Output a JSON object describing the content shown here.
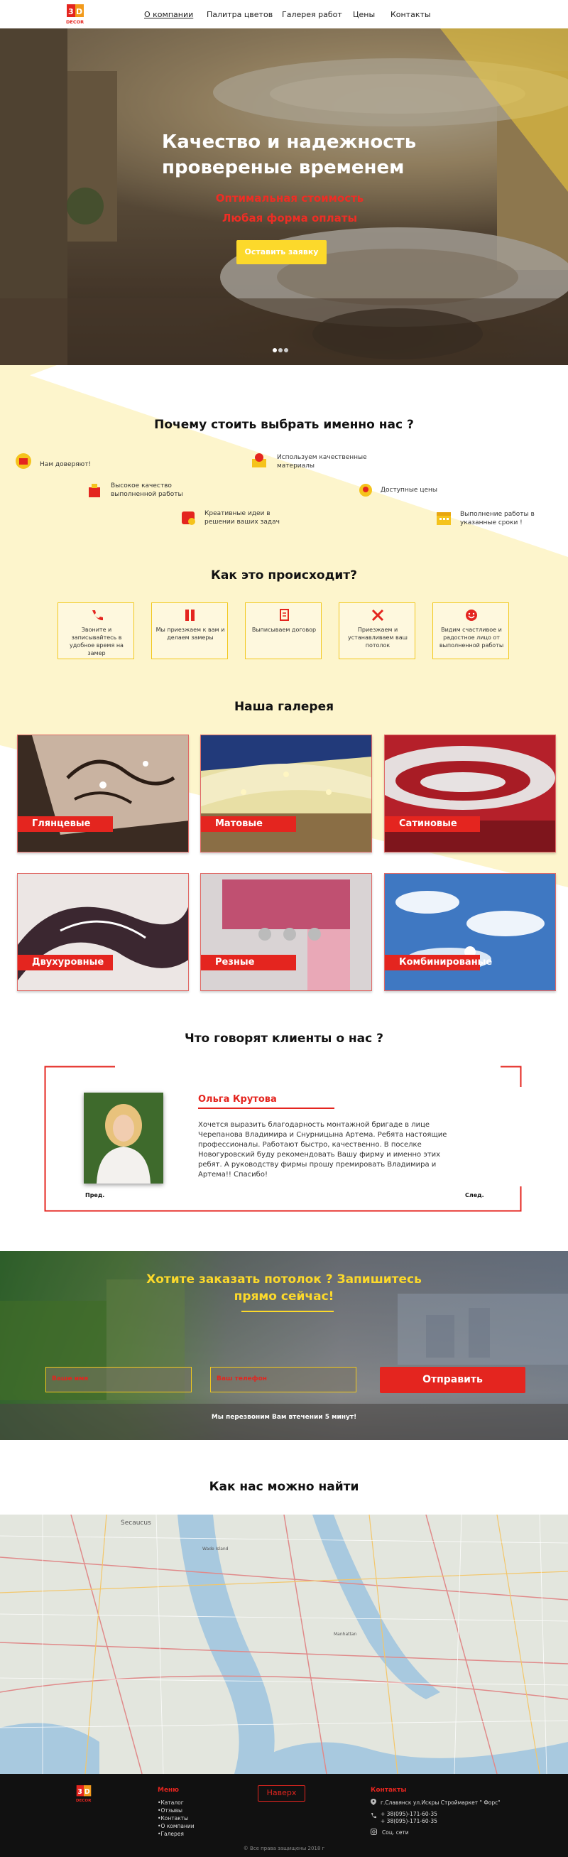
{
  "header": {
    "logo_text": "DECOR",
    "nav": [
      {
        "label": "О компании"
      },
      {
        "label": "Палитра цветов"
      },
      {
        "label": "Галерея работ"
      },
      {
        "label": "Цены"
      },
      {
        "label": "Контакты"
      }
    ]
  },
  "hero": {
    "title_line1": "Качество и надежность",
    "title_line2": "провереные временем",
    "subtitle_line1": "Оптимальная стоимость",
    "subtitle_line2": "Любая форма оплаты",
    "button_label": "Оставить заявку",
    "slides_count": 3
  },
  "why_us": {
    "title": "Почему стоить выбрать именно нас ?",
    "items": [
      {
        "label": "Нам доверяют!",
        "icon": "trust-icon"
      },
      {
        "label": "Используем качественные материалы",
        "icon": "materials-icon"
      },
      {
        "label": "Высокое качество выполненной работы",
        "icon": "quality-icon"
      },
      {
        "label": "Доступные цены",
        "icon": "price-icon"
      },
      {
        "label": "Креативные идеи в решении ваших задач",
        "icon": "idea-icon"
      },
      {
        "label": "Выполнение работы в указанные сроки !",
        "icon": "calendar-icon"
      }
    ]
  },
  "how_it_works": {
    "title": "Как это происходит?",
    "steps": [
      {
        "label": "Звоните и записывайтесь в удобное время на замер",
        "icon": "phone-icon"
      },
      {
        "label": "Мы приезжаем к вам и делаем замеры",
        "icon": "ruler-icon"
      },
      {
        "label": "Выписываем договор",
        "icon": "document-icon"
      },
      {
        "label": "Приезжаем и устанавливаем ваш потолок",
        "icon": "tools-icon"
      },
      {
        "label": "Видим счастливое и радостное лицо от выполненной работы",
        "icon": "smile-icon"
      }
    ]
  },
  "gallery": {
    "title": "Наша галерея",
    "items": [
      {
        "label": "Глянцевые"
      },
      {
        "label": "Матовые"
      },
      {
        "label": "Сатиновые"
      },
      {
        "label": "Двухуровные"
      },
      {
        "label": "Резные"
      },
      {
        "label": "Комбинированые"
      }
    ]
  },
  "reviews": {
    "title": "Что говорят клиенты о нас ?",
    "name": "Ольга Крутова",
    "text": "Хочется выразить благодарность монтажной бригаде в лице Черепанова Владимира и Снурницына Артема. Ребята настоящие профессионалы. Работают быстро, качественно. В поселке Новогуровский буду рекомендовать Вашу фирму и именно этих ребят. А руководству фирмы прошу премировать Владимира и Артема!! Спасибо!",
    "prev_label": "Пред.",
    "next_label": "След."
  },
  "order": {
    "title_line1": "Хотите заказать потолок ? Запишитесь",
    "title_line2": "прямо сейчас!",
    "name_placeholder": "Ваше имя",
    "phone_placeholder": "Ваш телефон",
    "submit_label": "Отправить",
    "note": "Мы перезвоним Вам втечении 5 минут!"
  },
  "map_section": {
    "title": "Как нас можно найти",
    "labels": [
      "Secaucus",
      "Wade Island",
      "Manhattan"
    ]
  },
  "footer": {
    "menu_title": "Меню",
    "menu_items": [
      "Каталог",
      "Отзывы",
      "Контакты",
      "О компании",
      "Галерея"
    ],
    "up_label": "Наверх",
    "contacts_title": "Контакты",
    "address": "г.Славянск ул.Искры Строймаркет \" Форс\"",
    "phone1": "+ 38(095)-171-60-35",
    "phone2": "+ 38(095)-171-60-35",
    "social": "Соц. сети",
    "copyright": "© Все права защищены 2018 г"
  },
  "colors": {
    "accent_red": "#e4251f",
    "accent_yellow": "#fcd92b",
    "footer_bg": "#111111"
  }
}
